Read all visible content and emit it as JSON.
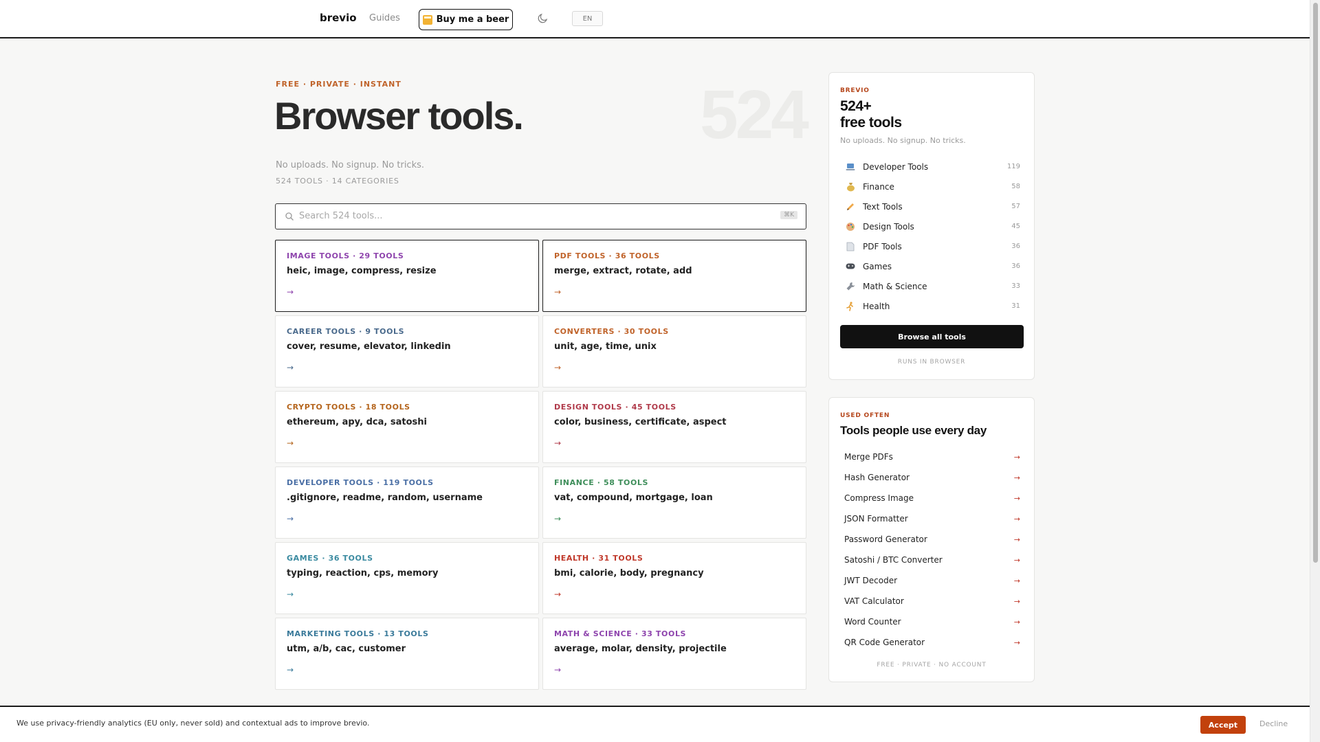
{
  "nav": {
    "brand": "brevio",
    "guides": "Guides",
    "beer_button": "Buy me a beer",
    "lang": "EN"
  },
  "hero": {
    "eyebrow": "FREE · PRIVATE · INSTANT",
    "title": "Browser tools.",
    "big_number": "524",
    "subtitle": "No uploads. No signup. No tricks.",
    "stats": "524 TOOLS · 14 CATEGORIES"
  },
  "search": {
    "placeholder": "Search 524 tools...",
    "shortcut": "⌘K"
  },
  "categories": [
    {
      "head": "IMAGE TOOLS · 29 TOOLS",
      "tags": "heic, image, compress, resize",
      "color": "#8e44ad",
      "active": true
    },
    {
      "head": "PDF TOOLS · 36 TOOLS",
      "tags": "merge, extract, rotate, add",
      "color": "#c0632a",
      "active": true
    },
    {
      "head": "CAREER TOOLS · 9 TOOLS",
      "tags": "cover, resume, elevator, linkedin",
      "color": "#4a6a8c",
      "active": false
    },
    {
      "head": "CONVERTERS · 30 TOOLS",
      "tags": "unit, age, time, unix",
      "color": "#c0632a",
      "active": false
    },
    {
      "head": "CRYPTO TOOLS · 18 TOOLS",
      "tags": "ethereum, apy, dca, satoshi",
      "color": "#b5651d",
      "active": false
    },
    {
      "head": "DESIGN TOOLS · 45 TOOLS",
      "tags": "color, business, certificate, aspect",
      "color": "#b03a4a",
      "active": false
    },
    {
      "head": "DEVELOPER TOOLS · 119 TOOLS",
      "tags": ".gitignore, readme, random, username",
      "color": "#4a6fa5",
      "active": false
    },
    {
      "head": "FINANCE · 58 TOOLS",
      "tags": "vat, compound, mortgage, loan",
      "color": "#3e8e5a",
      "active": false
    },
    {
      "head": "GAMES · 36 TOOLS",
      "tags": "typing, reaction, cps, memory",
      "color": "#3a8aa0",
      "active": false
    },
    {
      "head": "HEALTH · 31 TOOLS",
      "tags": "bmi, calorie, body, pregnancy",
      "color": "#c0392b",
      "active": false
    },
    {
      "head": "MARKETING TOOLS · 13 TOOLS",
      "tags": "utm, a/b, cac, customer",
      "color": "#3a7a9a",
      "active": false
    },
    {
      "head": "MATH & SCIENCE · 33 TOOLS",
      "tags": "average, molar, density, projectile",
      "color": "#8e44ad",
      "active": false
    }
  ],
  "sidebar": {
    "eyebrow": "BREVIO",
    "big_line1": "524+",
    "big_line2": "free tools",
    "small": "No uploads. No signup. No tricks.",
    "items": [
      {
        "name": "Developer Tools",
        "count": "119",
        "icon": "laptop-icon"
      },
      {
        "name": "Finance",
        "count": "58",
        "icon": "money-bag-icon"
      },
      {
        "name": "Text Tools",
        "count": "57",
        "icon": "pencil-icon"
      },
      {
        "name": "Design Tools",
        "count": "45",
        "icon": "palette-icon"
      },
      {
        "name": "PDF Tools",
        "count": "36",
        "icon": "document-icon"
      },
      {
        "name": "Games",
        "count": "36",
        "icon": "gamepad-icon"
      },
      {
        "name": "Math & Science",
        "count": "33",
        "icon": "wrench-icon"
      },
      {
        "name": "Health",
        "count": "31",
        "icon": "runner-icon"
      }
    ],
    "browse_button": "Browse all tools",
    "footer": "RUNS IN BROWSER"
  },
  "popular": {
    "eyebrow": "USED OFTEN",
    "title": "Tools people use every day",
    "items": [
      "Merge PDFs",
      "Hash Generator",
      "Compress Image",
      "JSON Formatter",
      "Password Generator",
      "Satoshi / BTC Converter",
      "JWT Decoder",
      "VAT Calculator",
      "Word Counter",
      "QR Code Generator"
    ],
    "footer": "FREE · PRIVATE · NO ACCOUNT"
  },
  "cookie": {
    "text": "We use privacy-friendly analytics (EU only, never sold) and contextual ads to improve brevio.",
    "accept": "Accept",
    "decline": "Decline"
  },
  "colors": {
    "accent": "#c2410c",
    "ink": "#111111"
  }
}
